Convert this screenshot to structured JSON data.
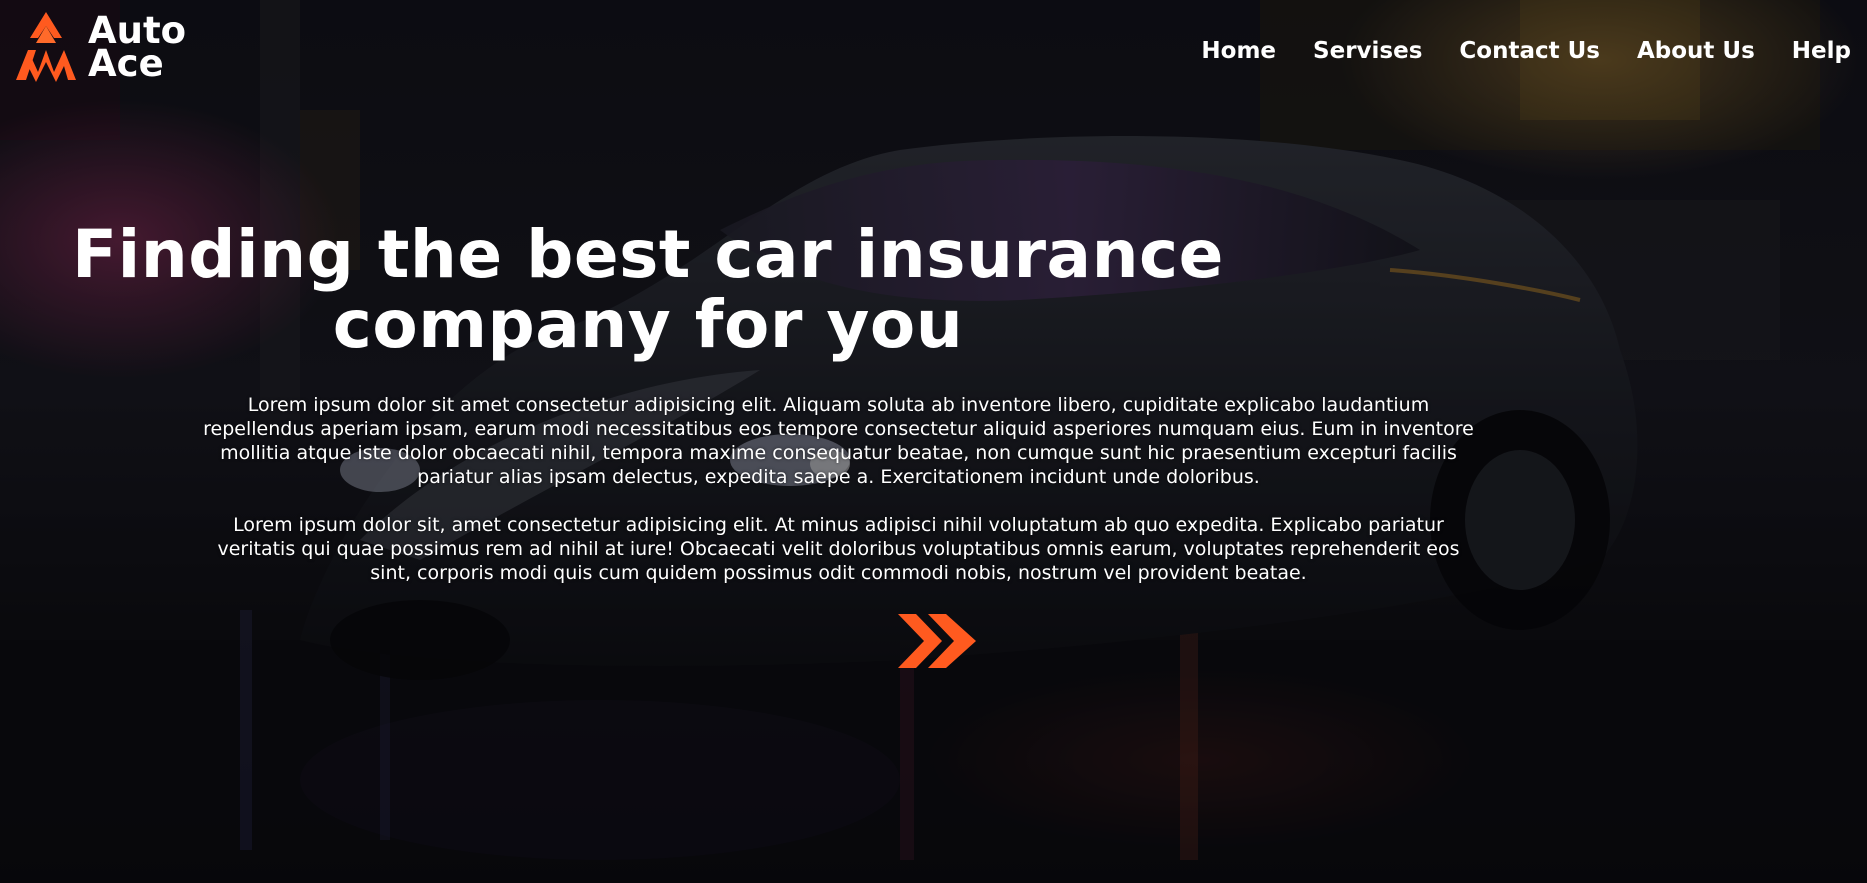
{
  "brand": {
    "line1": "Auto",
    "line2": "Ace",
    "logo_icon": "flame-logo-icon",
    "accent_color": "#ff5a1f"
  },
  "nav": {
    "items": [
      {
        "label": "Home"
      },
      {
        "label": "Servises"
      },
      {
        "label": "Contact Us"
      },
      {
        "label": "About Us"
      },
      {
        "label": "Help"
      }
    ]
  },
  "hero": {
    "title": "Finding the best car insurance company for you",
    "paragraph1": "Lorem ipsum dolor sit amet consectetur adipisicing elit. Aliquam soluta ab inventore libero, cupiditate explicabo laudantium repellendus aperiam ipsam, earum modi necessitatibus eos tempore consectetur aliquid asperiores numquam eius. Eum in inventore mollitia atque iste dolor obcaecati nihil, tempora maxime consequatur beatae, non cumque sunt hic praesentium excepturi facilis pariatur alias ipsam delectus, expedita saepe a. Exercitationem incidunt unde doloribus.",
    "paragraph2": "Lorem ipsum dolor sit, amet consectetur adipisicing elit. At minus adipisci nihil voluptatum ab quo expedita. Explicabo pariatur veritatis qui quae possimus rem ad nihil at iure! Obcaecati velit doloribus voluptatibus omnis earum, voluptates reprehenderit eos sint, corporis modi quis cum quidem possimus odit commodi nobis, nostrum vel provident beatae.",
    "cta_icon": "double-chevron-right-icon"
  }
}
